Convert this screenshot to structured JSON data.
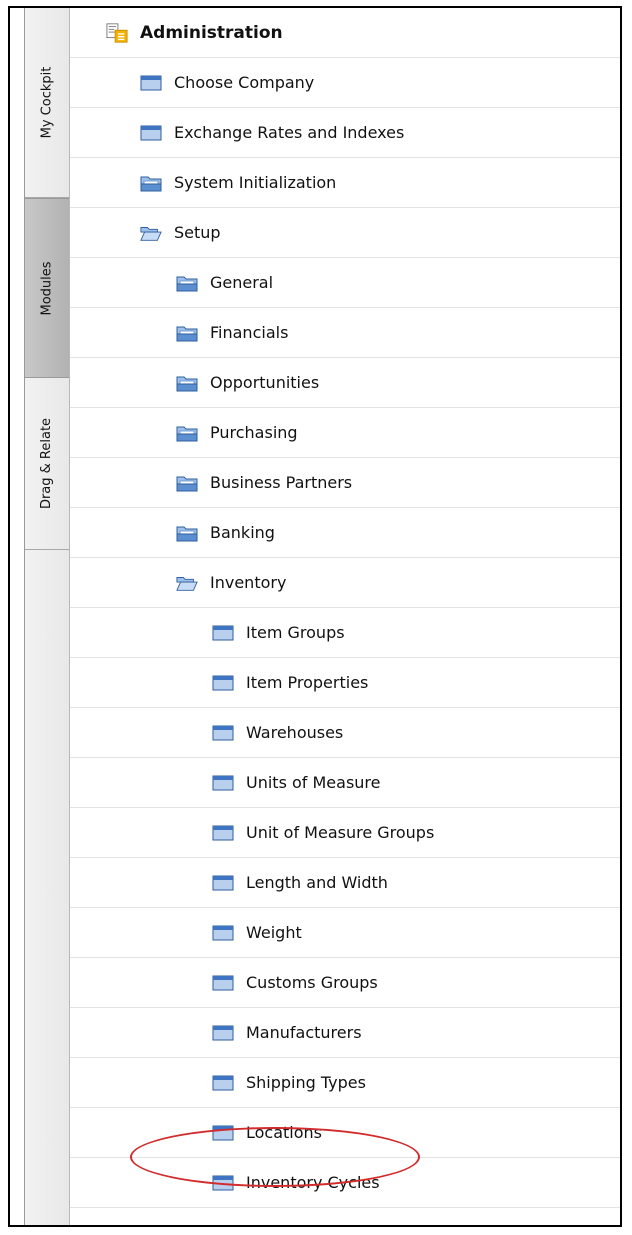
{
  "side_tabs": [
    {
      "label": "My Cockpit",
      "active": false
    },
    {
      "label": "Modules",
      "active": true
    },
    {
      "label": "Drag & Relate",
      "active": false
    }
  ],
  "tree": {
    "header": {
      "label": "Administration",
      "icon": "module-document-icon"
    },
    "items": [
      {
        "label": "Choose Company",
        "icon": "form-window-icon",
        "level": 1
      },
      {
        "label": "Exchange Rates and Indexes",
        "icon": "form-window-icon",
        "level": 1
      },
      {
        "label": "System Initialization",
        "icon": "folder-closed-icon",
        "level": 1
      },
      {
        "label": "Setup",
        "icon": "folder-open-icon",
        "level": 1
      },
      {
        "label": "General",
        "icon": "folder-closed-icon",
        "level": 2
      },
      {
        "label": "Financials",
        "icon": "folder-closed-icon",
        "level": 2
      },
      {
        "label": "Opportunities",
        "icon": "folder-closed-icon",
        "level": 2
      },
      {
        "label": "Purchasing",
        "icon": "folder-closed-icon",
        "level": 2
      },
      {
        "label": "Business Partners",
        "icon": "folder-closed-icon",
        "level": 2
      },
      {
        "label": "Banking",
        "icon": "folder-closed-icon",
        "level": 2
      },
      {
        "label": "Inventory",
        "icon": "folder-open-icon",
        "level": 2
      },
      {
        "label": "Item Groups",
        "icon": "form-window-icon",
        "level": 3
      },
      {
        "label": "Item Properties",
        "icon": "form-window-icon",
        "level": 3
      },
      {
        "label": "Warehouses",
        "icon": "form-window-icon",
        "level": 3
      },
      {
        "label": "Units of Measure",
        "icon": "form-window-icon",
        "level": 3
      },
      {
        "label": "Unit of Measure Groups",
        "icon": "form-window-icon",
        "level": 3
      },
      {
        "label": "Length and Width",
        "icon": "form-window-icon",
        "level": 3
      },
      {
        "label": "Weight",
        "icon": "form-window-icon",
        "level": 3
      },
      {
        "label": "Customs Groups",
        "icon": "form-window-icon",
        "level": 3
      },
      {
        "label": "Manufacturers",
        "icon": "form-window-icon",
        "level": 3
      },
      {
        "label": "Shipping Types",
        "icon": "form-window-icon",
        "level": 3
      },
      {
        "label": "Locations",
        "icon": "form-window-icon",
        "level": 3,
        "highlighted": true
      },
      {
        "label": "Inventory Cycles",
        "icon": "form-window-icon",
        "level": 3
      }
    ]
  },
  "colors": {
    "annotation_circle": "#d22b2b",
    "folder_icon": "#5b8fcf",
    "form_icon": "#3f74c2",
    "module_icon": "#f5b301"
  }
}
